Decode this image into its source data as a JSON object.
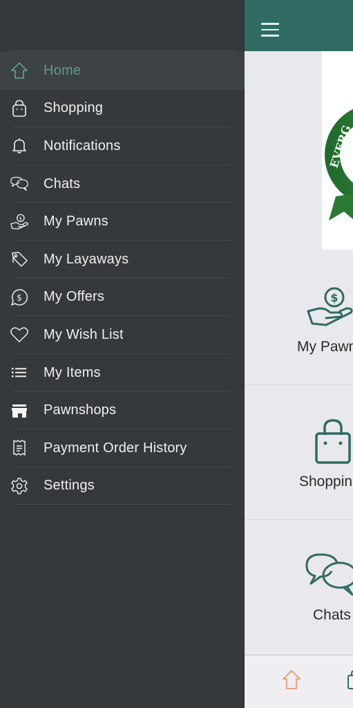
{
  "colors": {
    "drawer_bg": "#35393c",
    "active_item_bg": "#3d4245",
    "accent": "#5e9a92",
    "topbar": "#2f6b63",
    "main_bg": "#e9e8ed",
    "tab_home_active": "#e9a37e"
  },
  "drawer": {
    "items": [
      {
        "label": "Home",
        "icon": "home-icon",
        "active": true
      },
      {
        "label": "Shopping",
        "icon": "shopping-bag-icon"
      },
      {
        "label": "Notifications",
        "icon": "bell-icon"
      },
      {
        "label": "Chats",
        "icon": "chat-bubbles-icon"
      },
      {
        "label": "My Pawns",
        "icon": "hand-dollar-icon"
      },
      {
        "label": "My Layaways",
        "icon": "tag-icon"
      },
      {
        "label": "My Offers",
        "icon": "dollar-speech-icon"
      },
      {
        "label": "My Wish List",
        "icon": "heart-icon"
      },
      {
        "label": "My Items",
        "icon": "list-icon"
      },
      {
        "label": "Pawnshops",
        "icon": "store-icon"
      },
      {
        "label": "Payment Order History",
        "icon": "receipt-icon"
      },
      {
        "label": "Settings",
        "icon": "gear-icon"
      }
    ]
  },
  "main": {
    "banner_text": "EVERG",
    "tiles": [
      {
        "label": "My Pawns",
        "icon": "hand-dollar-icon"
      },
      {
        "label": "Shopping",
        "icon": "shopping-bag-icon"
      },
      {
        "label": "Chats",
        "icon": "chat-bubbles-icon"
      }
    ],
    "bottom_tabs": [
      {
        "icon": "home-icon",
        "active": true
      },
      {
        "icon": "shopping-bag-icon"
      }
    ]
  }
}
